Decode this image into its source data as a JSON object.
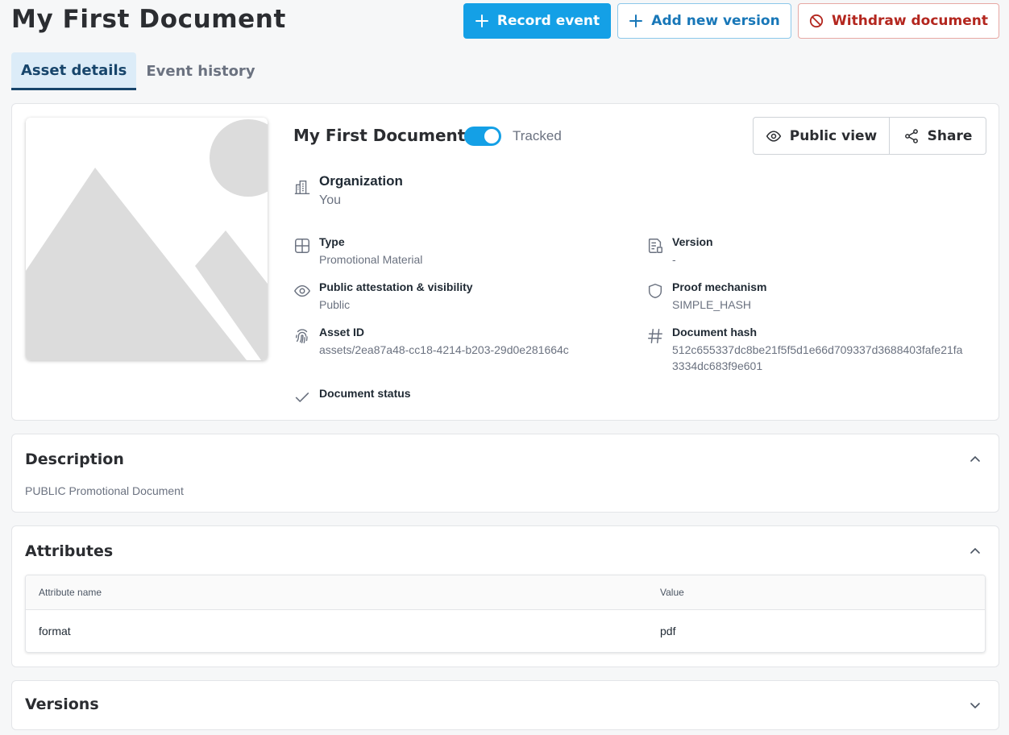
{
  "header": {
    "title": "My First Document",
    "record_event_label": "Record event",
    "add_version_label": "Add new version",
    "withdraw_label": "Withdraw document"
  },
  "tabs": [
    {
      "label": "Asset details",
      "active": true
    },
    {
      "label": "Event history",
      "active": false
    }
  ],
  "asset": {
    "title": "My First Document",
    "tracked_label": "Tracked",
    "tracked": true,
    "public_view_label": "Public view",
    "share_label": "Share",
    "organization": {
      "label": "Organization",
      "value": "You"
    },
    "fields": {
      "type": {
        "label": "Type",
        "value": "Promotional Material"
      },
      "version": {
        "label": "Version",
        "value": "-"
      },
      "visibility": {
        "label": "Public attestation & visibility",
        "value": "Public"
      },
      "proof": {
        "label": "Proof mechanism",
        "value": "SIMPLE_HASH"
      },
      "asset_id": {
        "label": "Asset ID",
        "value": "assets/2ea87a48-cc18-4214-b203-29d0e281664c"
      },
      "hash": {
        "label": "Document hash",
        "value_line1": "512c655337dc8be21f5f5d1e66d709337d3688403fafe21fa",
        "value_line2": "3334dc683f9e601"
      },
      "status": {
        "label": "Document status"
      }
    }
  },
  "description": {
    "title": "Description",
    "text": "PUBLIC Promotional Document"
  },
  "attributes": {
    "title": "Attributes",
    "columns": [
      "Attribute name",
      "Value"
    ],
    "rows": [
      {
        "name": "format",
        "value": "pdf"
      }
    ]
  },
  "versions": {
    "title": "Versions"
  },
  "colors": {
    "primary": "#14a0e6",
    "danger": "#b3261e",
    "tab_active_bg": "#dcecf8"
  },
  "icons": {
    "record": "plus-icon",
    "add_version": "plus-icon",
    "withdraw": "ban-icon",
    "public_view": "eye-icon",
    "share": "share-icon",
    "organization": "building-icon",
    "type": "grid-icon",
    "version": "document-list-icon",
    "visibility": "eye-icon",
    "proof": "shield-icon",
    "asset_id": "fingerprint-icon",
    "hash": "hash-icon",
    "status": "check-icon"
  }
}
